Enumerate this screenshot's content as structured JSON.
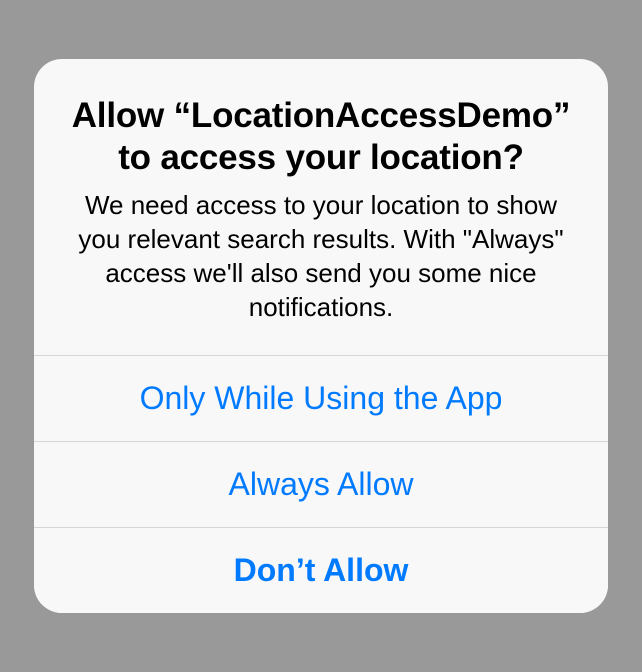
{
  "alert": {
    "title": "Allow “LocationAccessDemo” to access your location?",
    "message": "We need access to your location to show you relevant search results. With \"Always\" access we'll also send you some nice notifications.",
    "buttons": {
      "only_while_using": "Only While Using the App",
      "always_allow": "Always Allow",
      "dont_allow": "Don’t Allow"
    },
    "accent_color": "#007aff"
  }
}
